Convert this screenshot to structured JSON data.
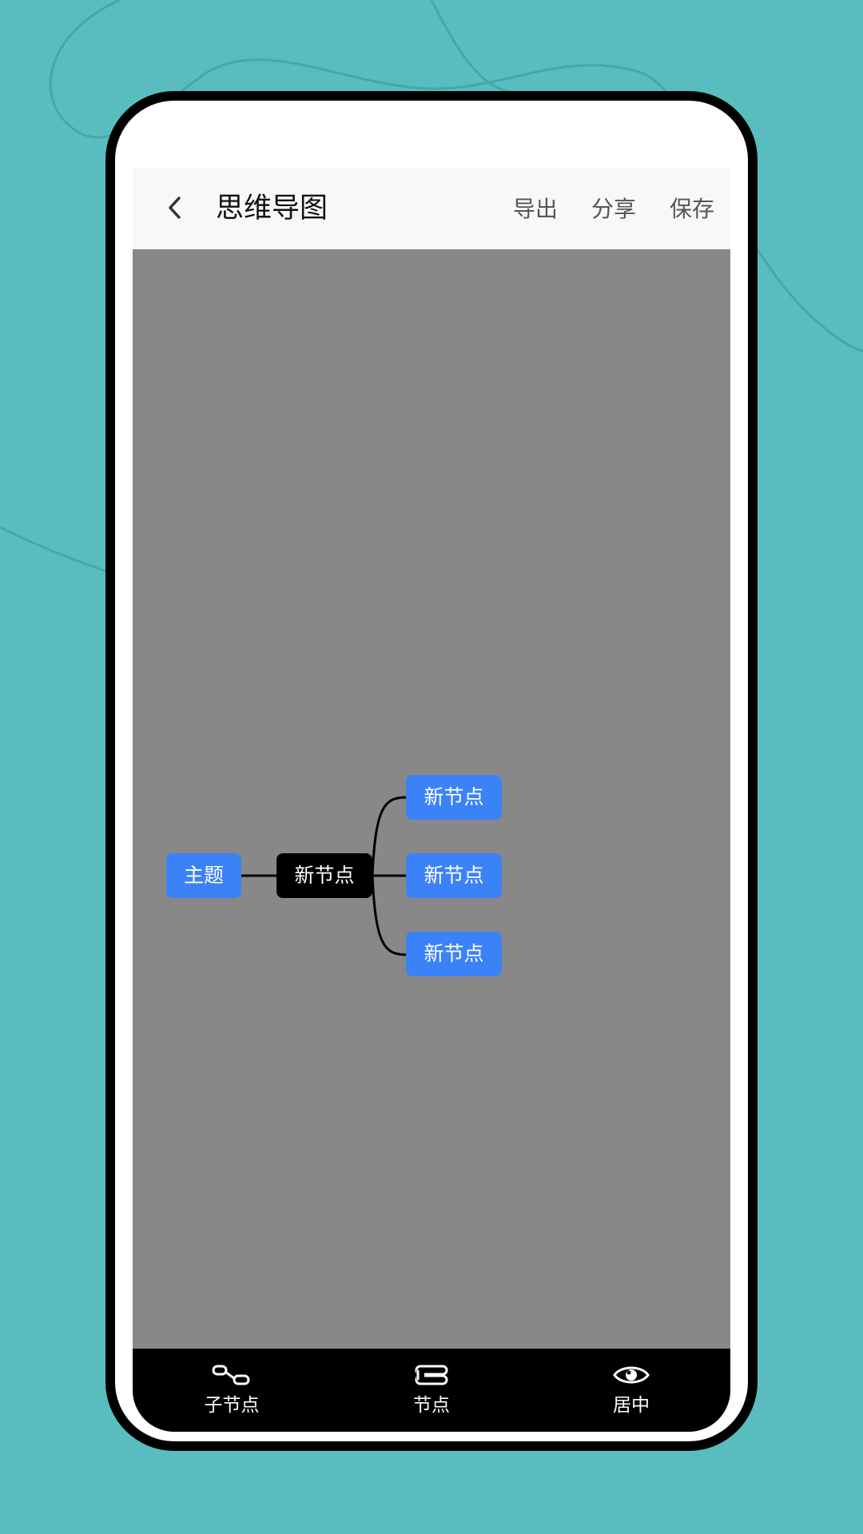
{
  "header": {
    "title": "思维导图",
    "actions": [
      "导出",
      "分享",
      "保存"
    ]
  },
  "mindmap": {
    "root": "主题",
    "child": "新节点",
    "grandchildren": [
      "新节点",
      "新节点",
      "新节点"
    ]
  },
  "toolbar": {
    "items": [
      {
        "label": "子节点",
        "icon": "child-node-icon"
      },
      {
        "label": "节点",
        "icon": "sibling-node-icon"
      },
      {
        "label": "居中",
        "icon": "eye-icon"
      }
    ]
  },
  "colors": {
    "background": "#59bdbf",
    "canvas": "#888888",
    "node_blue": "#3b82f6",
    "node_selected": "#000000",
    "toolbar": "#000000"
  }
}
